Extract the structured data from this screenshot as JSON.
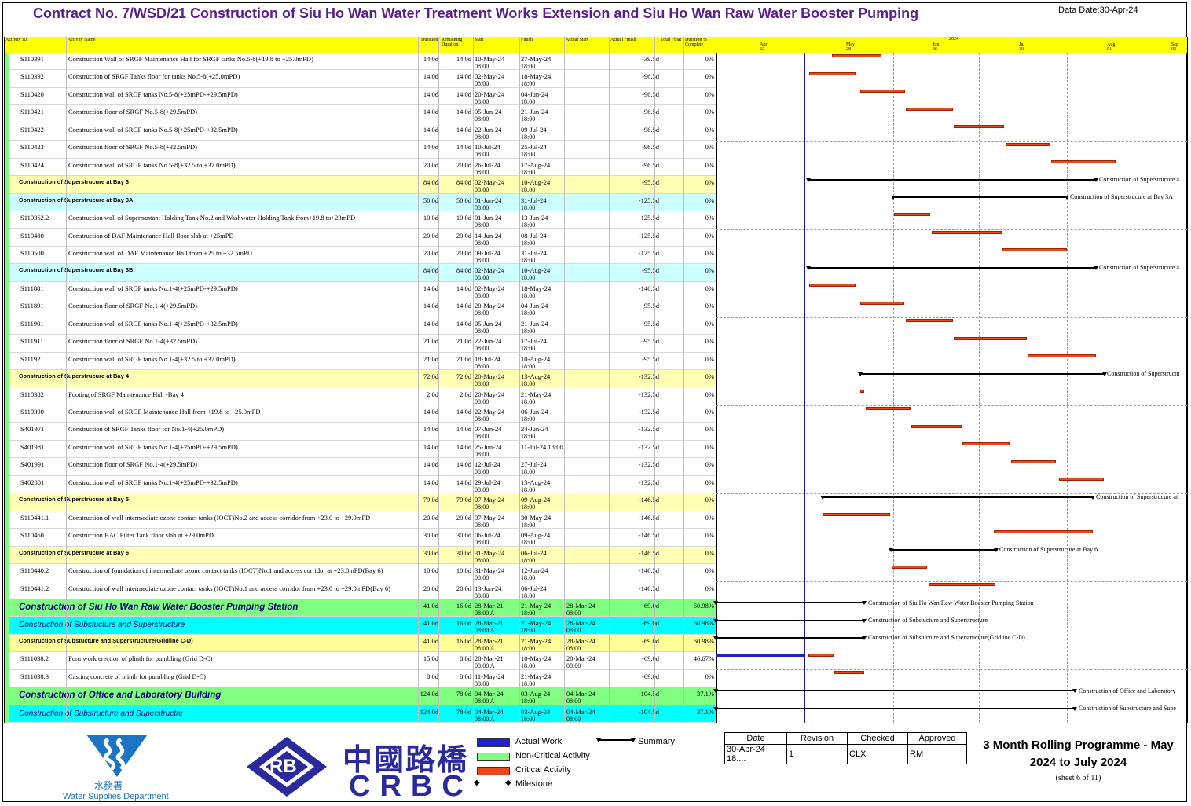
{
  "header": {
    "title": "Contract No. 7/WSD/21 Construction of Siu Ho Wan Water Treatment Works Extension and Siu Ho Wan Raw Water Booster Pumping",
    "data_date": "Data Date:30-Apr-24"
  },
  "columns": {
    "activity_id": "Activity ID",
    "activity_name": "Activity Name",
    "duration": "Duration",
    "remaining": "Remaining Duration",
    "start": "Start",
    "finish": "Finish",
    "actual_start": "Actual Start",
    "actual_finish": "Actual Finish",
    "total_float": "Total Float",
    "complete": "Duration % Complete"
  },
  "timeline": {
    "year": "2024",
    "months": [
      "Apr",
      "May",
      "Jun",
      "Jul",
      "Aug",
      "Sep"
    ],
    "weeks": [
      "22",
      "28",
      "26",
      "30",
      "01",
      "02"
    ]
  },
  "rows": [
    {
      "type": "task",
      "id": "S110391",
      "name": "Construction Wall of SRGF Maintenance Hall for SRGF tanks No.5-8(+19.8 to +25.0mPD)",
      "dur": "14.0d",
      "rem": "14.0d",
      "start": "10-May-24",
      "start2": "08:00",
      "finish": "27-May-24",
      "finish2": "18:00",
      "astart": "",
      "afinish": "",
      "tf": "-39.5d",
      "pc": "0%"
    },
    {
      "type": "task",
      "id": "S110392",
      "name": "Construction of SRGF Tanks floor for tanks No.5-8(+25.0mPD)",
      "dur": "14.0d",
      "rem": "14.0d",
      "start": "02-May-24",
      "start2": "08:00",
      "finish": "18-May-24",
      "finish2": "18:00",
      "astart": "",
      "afinish": "",
      "tf": "-96.5d",
      "pc": "0%"
    },
    {
      "type": "task",
      "id": "S110420",
      "name": "Construction wall of SRGF tanks No.5-8(+25mPD-+29.5mPD)",
      "dur": "14.0d",
      "rem": "14.0d",
      "start": "20-May-24",
      "start2": "08:00",
      "finish": "04-Jun-24",
      "finish2": "18:00",
      "astart": "",
      "afinish": "",
      "tf": "-96.5d",
      "pc": "0%"
    },
    {
      "type": "task",
      "id": "S110421",
      "name": "Construction floor of SRGF No.5-8(+29.5mPD)",
      "dur": "14.0d",
      "rem": "14.0d",
      "start": "05-Jun-24",
      "start2": "08:00",
      "finish": "21-Jun-24",
      "finish2": "18:00",
      "astart": "",
      "afinish": "",
      "tf": "-96.5d",
      "pc": "0%"
    },
    {
      "type": "task",
      "id": "S110422",
      "name": "Construction wall of SRGF tanks No.5-8(+25mPD-+32.5mPD)",
      "dur": "14.0d",
      "rem": "14.0d",
      "start": "22-Jun-24",
      "start2": "08:00",
      "finish": "09-Jul-24",
      "finish2": "18:00",
      "astart": "",
      "afinish": "",
      "tf": "-96.5d",
      "pc": "0%"
    },
    {
      "type": "task",
      "id": "S110423",
      "name": "Construction floor of SRGF No.5-8(+32.5mPD)",
      "dur": "14.0d",
      "rem": "14.0d",
      "start": "10-Jul-24",
      "start2": "08:00",
      "finish": "25-Jul-24",
      "finish2": "18:00",
      "astart": "",
      "afinish": "",
      "tf": "-96.5d",
      "pc": "0%"
    },
    {
      "type": "task",
      "id": "S110424",
      "name": "Construction wall of SRGF tanks No.5-8(+32.5 to +37.0mPD)",
      "dur": "20.0d",
      "rem": "20.0d",
      "start": "26-Jul-24",
      "start2": "08:00",
      "finish": "17-Aug-24",
      "finish2": "18:00",
      "astart": "",
      "afinish": "",
      "tf": "-96.5d",
      "pc": "0%"
    },
    {
      "type": "bay",
      "id": "",
      "name": "Construction of Superstrucure at Bay 3",
      "dur": "84.0d",
      "rem": "84.0d",
      "start": "02-May-24",
      "start2": "08:00",
      "finish": "10-Aug-24",
      "finish2": "18:00",
      "astart": "",
      "afinish": "",
      "tf": "-95.5d",
      "pc": "0%"
    },
    {
      "type": "sub",
      "id": "",
      "name": "Construction of Superstrucure at Bay 3A",
      "dur": "50.0d",
      "rem": "50.0d",
      "start": "01-Jun-24",
      "start2": "08:00",
      "finish": "31-Jul-24",
      "finish2": "18:00",
      "astart": "",
      "afinish": "",
      "tf": "-125.5d",
      "pc": "0%"
    },
    {
      "type": "task",
      "id": "S110362.2",
      "name": "Construction wall of Supernantant Holding Tank No.2 and Washwater Holding Tank from+19.8 to+23mPD",
      "dur": "10.0d",
      "rem": "10.0d",
      "start": "01-Jun-24",
      "start2": "08:00",
      "finish": "13-Jun-24",
      "finish2": "18:00",
      "astart": "",
      "afinish": "",
      "tf": "-125.5d",
      "pc": "0%"
    },
    {
      "type": "task",
      "id": "S110480",
      "name": "Construction of DAF Maintenance Hall floor slab at +25mPD",
      "dur": "20.0d",
      "rem": "20.0d",
      "start": "14-Jun-24",
      "start2": "08:00",
      "finish": "08-Jul-24",
      "finish2": "18:00",
      "astart": "",
      "afinish": "",
      "tf": "-125.5d",
      "pc": "0%"
    },
    {
      "type": "task",
      "id": "S110500",
      "name": "Construction wall of DAF Maintenance Hall from +25 to +32.5mPD",
      "dur": "20.0d",
      "rem": "20.0d",
      "start": "09-Jul-24",
      "start2": "08:00",
      "finish": "31-Jul-24",
      "finish2": "18:00",
      "astart": "",
      "afinish": "",
      "tf": "-125.5d",
      "pc": "0%"
    },
    {
      "type": "sub",
      "id": "",
      "name": "Construction of Superstrucure at Bay 3B",
      "dur": "84.0d",
      "rem": "84.0d",
      "start": "02-May-24",
      "start2": "08:00",
      "finish": "10-Aug-24",
      "finish2": "18:00",
      "astart": "",
      "afinish": "",
      "tf": "-95.5d",
      "pc": "0%"
    },
    {
      "type": "task",
      "id": "S111881",
      "name": "Construction wall of SRGF tanks No.1-4(+25mPD-+29.5mPD)",
      "dur": "14.0d",
      "rem": "14.0d",
      "start": "02-May-24",
      "start2": "08:00",
      "finish": "18-May-24",
      "finish2": "18:00",
      "astart": "",
      "afinish": "",
      "tf": "-146.5d",
      "pc": "0%"
    },
    {
      "type": "task",
      "id": "S111891",
      "name": "Construction floor of SRGF No.1-4(+29.5mPD)",
      "dur": "14.0d",
      "rem": "14.0d",
      "start": "20-May-24",
      "start2": "08:00",
      "finish": "04-Jun-24",
      "finish2": "18:00",
      "astart": "",
      "afinish": "",
      "tf": "-95.5d",
      "pc": "0%"
    },
    {
      "type": "task",
      "id": "S111901",
      "name": "Construction wall of SRGF tanks No.1-4(+25mPD-+32.5mPD)",
      "dur": "14.0d",
      "rem": "14.0d",
      "start": "05-Jun-24",
      "start2": "08:00",
      "finish": "21-Jun-24",
      "finish2": "18:00",
      "astart": "",
      "afinish": "",
      "tf": "-95.5d",
      "pc": "0%"
    },
    {
      "type": "task",
      "id": "S111911",
      "name": "Construction floor of SRGF No.1-4(+32.5mPD)",
      "dur": "21.0d",
      "rem": "21.0d",
      "start": "22-Jun-24",
      "start2": "08:00",
      "finish": "17-Jul-24",
      "finish2": "18:00",
      "astart": "",
      "afinish": "",
      "tf": "-95.5d",
      "pc": "0%"
    },
    {
      "type": "task",
      "id": "S111921",
      "name": "Construction wall of SRGF tanks No.1-4(+32.5 to +37.0mPD)",
      "dur": "21.0d",
      "rem": "21.0d",
      "start": "18-Jul-24",
      "start2": "08:00",
      "finish": "10-Aug-24",
      "finish2": "18:00",
      "astart": "",
      "afinish": "",
      "tf": "-95.5d",
      "pc": "0%"
    },
    {
      "type": "bay",
      "id": "",
      "name": "Construction of Superstrucure at Bay 4",
      "dur": "72.0d",
      "rem": "72.0d",
      "start": "20-May-24",
      "start2": "08:00",
      "finish": "13-Aug-24",
      "finish2": "18:00",
      "astart": "",
      "afinish": "",
      "tf": "-132.5d",
      "pc": "0%"
    },
    {
      "type": "task",
      "id": "S110382",
      "name": "Footing of SRGF Maintenance Hall -Bay 4",
      "dur": "2.0d",
      "rem": "2.0d",
      "start": "20-May-24",
      "start2": "08:00",
      "finish": "21-May-24",
      "finish2": "18:00",
      "astart": "",
      "afinish": "",
      "tf": "-132.5d",
      "pc": "0%"
    },
    {
      "type": "task",
      "id": "S110390",
      "name": "Construction wall of SRGF Maintenance Hall from +19.8 to +25.0mPD",
      "dur": "14.0d",
      "rem": "14.0d",
      "start": "22-May-24",
      "start2": "08:00",
      "finish": "06-Jun-24",
      "finish2": "18:00",
      "astart": "",
      "afinish": "",
      "tf": "-132.5d",
      "pc": "0%"
    },
    {
      "type": "task",
      "id": "S401971",
      "name": "Construction of SRGF Tanks floor for No.1-4(+25.0mPD)",
      "dur": "14.0d",
      "rem": "14.0d",
      "start": "07-Jun-24",
      "start2": "08:00",
      "finish": "24-Jun-24",
      "finish2": "18:00",
      "astart": "",
      "afinish": "",
      "tf": "-132.5d",
      "pc": "0%"
    },
    {
      "type": "task",
      "id": "S401981",
      "name": "Construction wall of SRGF tanks No.1-4(+25mPD-+29.5mPD)",
      "dur": "14.0d",
      "rem": "14.0d",
      "start": "25-Jun-24",
      "start2": "08:00",
      "finish": "11-Jul-24 18:00",
      "finish2": "",
      "astart": "",
      "afinish": "",
      "tf": "-132.5d",
      "pc": "0%"
    },
    {
      "type": "task",
      "id": "S401991",
      "name": "Construction floor of SRGF No.1-4(+29.5mPD)",
      "dur": "14.0d",
      "rem": "14.0d",
      "start": "12-Jul-24",
      "start2": "08:00",
      "finish": "27-Jul-24",
      "finish2": "18:00",
      "astart": "",
      "afinish": "",
      "tf": "-132.5d",
      "pc": "0%"
    },
    {
      "type": "task",
      "id": "S402001",
      "name": "Construction wall of SRGF tanks No.1-4(+25mPD-+32.5mPD)",
      "dur": "14.0d",
      "rem": "14.0d",
      "start": "29-Jul-24",
      "start2": "08:00",
      "finish": "13-Aug-24",
      "finish2": "18:00",
      "astart": "",
      "afinish": "",
      "tf": "-132.5d",
      "pc": "0%"
    },
    {
      "type": "bay",
      "id": "",
      "name": "Construction of Superstrucure at Bay 5",
      "dur": "79.0d",
      "rem": "79.0d",
      "start": "07-May-24",
      "start2": "08:00",
      "finish": "09-Aug-24",
      "finish2": "18:00",
      "astart": "",
      "afinish": "",
      "tf": "-146.5d",
      "pc": "0%"
    },
    {
      "type": "task",
      "id": "S110441.1",
      "name": "Construction of wall intermediate ozone contact tanks (IOCT)No.2 and access corridor from +23.0 to +29.0mPD",
      "dur": "20.0d",
      "rem": "20.0d",
      "start": "07-May-24",
      "start2": "08:00",
      "finish": "30-May-24",
      "finish2": "18:00",
      "astart": "",
      "afinish": "",
      "tf": "-146.5d",
      "pc": "0%"
    },
    {
      "type": "task",
      "id": "S110460",
      "name": "Construction BAC Filter Tank floor slab at +29.0mPD",
      "dur": "30.0d",
      "rem": "30.0d",
      "start": "06-Jul-24",
      "start2": "08:00",
      "finish": "09-Aug-24",
      "finish2": "18:00",
      "astart": "",
      "afinish": "",
      "tf": "-146.5d",
      "pc": "0%"
    },
    {
      "type": "bay",
      "id": "",
      "name": "Construction of Superstrucure at Bay 6",
      "dur": "30.0d",
      "rem": "30.0d",
      "start": "31-May-24",
      "start2": "08:00",
      "finish": "06-Jul-24",
      "finish2": "18:00",
      "astart": "",
      "afinish": "",
      "tf": "-146.5d",
      "pc": "0%"
    },
    {
      "type": "task",
      "id": "S110440.2",
      "name": "Construction of foundation of intermediate ozone contact tanks (IOCT)No.1 and access corridor at +23.0mPD(Bay 6)",
      "dur": "10.0d",
      "rem": "10.0d",
      "start": "31-May-24",
      "start2": "08:00",
      "finish": "12-Jun-24",
      "finish2": "18:00",
      "astart": "",
      "afinish": "",
      "tf": "-146.5d",
      "pc": "0%"
    },
    {
      "type": "task",
      "id": "S110441.2",
      "name": "Construction of wall intermediate ozone contact tanks (IOCT)No.1 and access corridor from +23.0 to +29.0mPD(Bay 6)",
      "dur": "20.0d",
      "rem": "20.0d",
      "start": "13-Jun-24",
      "start2": "08:00",
      "finish": "06-Jul-24",
      "finish2": "18:00",
      "astart": "",
      "afinish": "",
      "tf": "-146.5d",
      "pc": "0%"
    },
    {
      "type": "big",
      "id": "",
      "name": "Construction of Siu Ho Wan Raw Water Booster Pumping Station",
      "dur": "41.0d",
      "rem": "16.0d",
      "start": "28-Mar-21",
      "start2": "08:00 A",
      "finish": "21-May-24",
      "finish2": "18:00",
      "astart": "28-Mar-24",
      "afinish": "08:00",
      "tf": "-69.0d",
      "pc": "60.98%"
    },
    {
      "type": "cyan",
      "id": "",
      "name": "Construction of Substucture and Superstructure",
      "dur": "41.0d",
      "rem": "16.0d",
      "start": "28-Mar-21",
      "start2": "08:00 A",
      "finish": "21-May-24",
      "finish2": "18:00",
      "astart": "28-Mar-24",
      "afinish": "08:00",
      "tf": "-69.0d",
      "pc": "60.98%"
    },
    {
      "type": "yel",
      "id": "",
      "name": "Construction of Substucture and Superstructure(Gridline C-D)",
      "dur": "41.0d",
      "rem": "16.0d",
      "start": "28-Mar-21",
      "start2": "08:00 A",
      "finish": "21-May-24",
      "finish2": "18:00",
      "astart": "28-Mar-24",
      "afinish": "08:00",
      "tf": "-69.0d",
      "pc": "60.98%"
    },
    {
      "type": "task",
      "id": "S111038.2",
      "name": "Formwork erection of plinth for pumbling (Grid D-C)",
      "dur": "15.0d",
      "rem": "8.0d",
      "start": "28-Mar-21",
      "start2": "08:00 A",
      "finish": "10-May-24",
      "finish2": "18:00",
      "astart": "28-Mar-24",
      "afinish": "08:00",
      "tf": "-69.0d",
      "pc": "46.67%"
    },
    {
      "type": "task",
      "id": "S111038.3",
      "name": "Casting concrete of plinth for pumbling (Grid D-C)",
      "dur": "8.0d",
      "rem": "8.0d",
      "start": "11-May-24",
      "start2": "08:00",
      "finish": "21-May-24",
      "finish2": "18:00",
      "astart": "",
      "afinish": "",
      "tf": "-69.0d",
      "pc": "0%"
    },
    {
      "type": "big",
      "id": "",
      "name": "Construction of Office and Laboratory Building",
      "dur": "124.0d",
      "rem": "78.0d",
      "start": "04-Mar-24",
      "start2": "08:00 A",
      "finish": "03-Aug-24",
      "finish2": "18:00",
      "astart": "04-Mar-24",
      "afinish": "08:00",
      "tf": "-104.5d",
      "pc": "37.1%"
    },
    {
      "type": "cyan",
      "id": "",
      "name": "Construction of Substructure and Superstructre",
      "dur": "124.0d",
      "rem": "78.0d",
      "start": "04-Mar-24",
      "start2": "08:00 A",
      "finish": "03-Aug-24",
      "finish2": "18:00",
      "astart": "04-Mar-24",
      "afinish": "08:00",
      "tf": "-104.5d",
      "pc": "37.1%"
    }
  ],
  "gantt_labels": {
    "bay3": "Construction of Superstrucure a",
    "bay3a": "Construction of Superstrucure at Bay 3A",
    "bay3b": "Construction of Superstrucure a",
    "bay4": "Construction of Superstructu",
    "bay5": "Construction of Superstrucure at",
    "bay6": "Construction of Superstrucure at Bay 6",
    "pump": "Construction of Siu Ho Wan Raw Water Booster Pumping Station",
    "sub1": "Construction of Substucture and Superstructure",
    "sub2": "Construction of Substucture and Superstructure(Gridline C-D)",
    "office": "Construction of Office and Laboratory",
    "office_sub": "Construction of Substructure and Supe"
  },
  "footer": {
    "wsd_chinese": "水務署",
    "wsd_english": "Water Supplies Department",
    "rb": "RB",
    "crbc_chinese": "中國路橋",
    "crbc": "CRBC",
    "legend": {
      "actual": "Actual Work",
      "noncritical": "Non-Critical Activity",
      "critical": "Critical Activity",
      "milestone": "Milestone",
      "summary": "Summary"
    },
    "info_headers": [
      "Date",
      "Revision",
      "Checked",
      "Approved"
    ],
    "info_values": [
      "30-Apr-24 18:...",
      "1",
      "CLX",
      "RM"
    ],
    "report_title": "3 Month Rolling Programme - May 2024 to July 2024",
    "sheet": "(sheet 6 of 11)"
  },
  "colors": {
    "title": "#5b1e8f",
    "critical": "#e8481c",
    "actual": "#1f1fd0",
    "noncritical": "#80ff80",
    "header": "#ffff00"
  }
}
